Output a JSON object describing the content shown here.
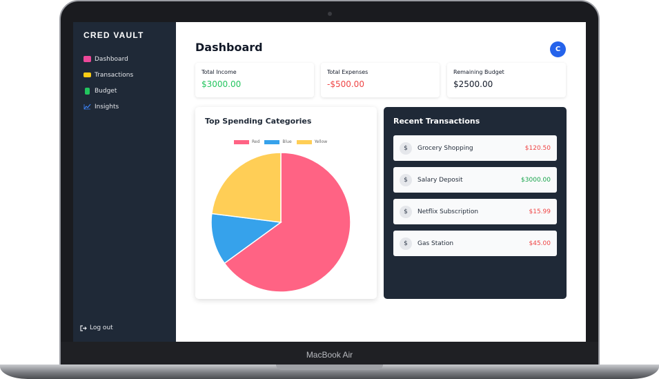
{
  "device": {
    "label": "MacBook Air"
  },
  "sidebar": {
    "brand": "CRED VAULT",
    "items": [
      {
        "label": "Dashboard",
        "icon": "wallet-icon",
        "color": "#ec4899"
      },
      {
        "label": "Transactions",
        "icon": "card-icon",
        "color": "#facc15"
      },
      {
        "label": "Budget",
        "icon": "budget-icon",
        "color": "#22c55e"
      },
      {
        "label": "Insights",
        "icon": "chart-line-icon",
        "color": "#3b82f6"
      }
    ],
    "logout": "Log out"
  },
  "header": {
    "title": "Dashboard",
    "avatar_initial": "C"
  },
  "stats": [
    {
      "label": "Total Income",
      "value": "$3000.00",
      "color": "#22c55e"
    },
    {
      "label": "Total Expenses",
      "value": "-$500.00",
      "color": "#ef4444"
    },
    {
      "label": "Remaining Budget",
      "value": "$2500.00",
      "color": "#111827"
    }
  ],
  "spending_chart": {
    "title": "Top Spending Categories",
    "chart_data": {
      "type": "pie",
      "categories": [
        "Red",
        "Blue",
        "Yellow"
      ],
      "values": [
        65,
        12,
        23
      ],
      "colors": [
        "#ff6384",
        "#36a2eb",
        "#ffce56"
      ],
      "legend": "top"
    }
  },
  "transactions": {
    "title": "Recent Transactions",
    "items": [
      {
        "name": "Grocery Shopping",
        "amount": "$120.50",
        "type": "expense"
      },
      {
        "name": "Salary Deposit",
        "amount": "$3000.00",
        "type": "income"
      },
      {
        "name": "Netflix Subscription",
        "amount": "$15.99",
        "type": "expense"
      },
      {
        "name": "Gas Station",
        "amount": "$45.00",
        "type": "expense"
      }
    ],
    "icon_glyph": "$",
    "expense_color": "#ef4444",
    "income_color": "#16a34a"
  }
}
